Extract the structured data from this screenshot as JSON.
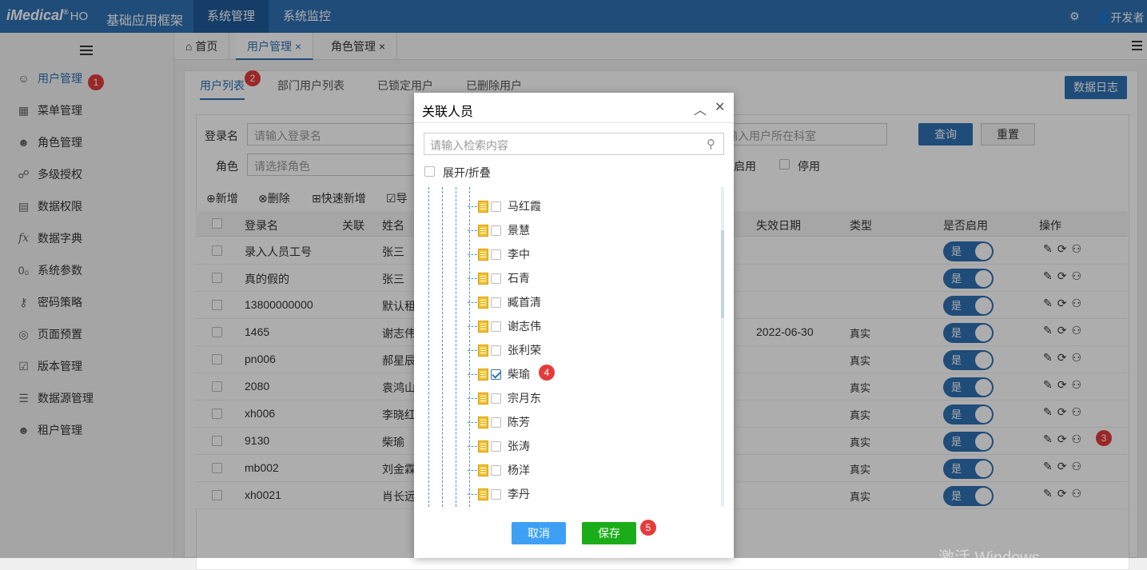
{
  "app": {
    "logo": "iMedical",
    "logo_suffix": "HO",
    "title": "基础应用框架",
    "nav": [
      "系统管理",
      "系统监控"
    ],
    "user": "开发者"
  },
  "sidebar": {
    "items": [
      {
        "label": "用户管理",
        "icon": "user-icon"
      },
      {
        "label": "菜单管理",
        "icon": "grid-icon"
      },
      {
        "label": "角色管理",
        "icon": "role-icon"
      },
      {
        "label": "多级授权",
        "icon": "multi-auth-icon"
      },
      {
        "label": "数据权限",
        "icon": "data-permission-icon"
      },
      {
        "label": "数据字典",
        "icon": "function-icon"
      },
      {
        "label": "系统参数",
        "icon": "param-icon"
      },
      {
        "label": "密码策略",
        "icon": "key-icon"
      },
      {
        "label": "页面预置",
        "icon": "layers-icon"
      },
      {
        "label": "版本管理",
        "icon": "version-icon"
      },
      {
        "label": "数据源管理",
        "icon": "datasource-icon"
      },
      {
        "label": "租户管理",
        "icon": "tenant-icon"
      }
    ]
  },
  "tabs": [
    {
      "label": "首页"
    },
    {
      "label": "用户管理",
      "close": "×"
    },
    {
      "label": "角色管理",
      "close": "×"
    }
  ],
  "subtabs": [
    "用户列表",
    "部门用户列表",
    "已锁定用户",
    "已删除用户"
  ],
  "data_log_button": "数据日志",
  "filters": {
    "login_label": "登录名",
    "login_placeholder": "请输入登录名",
    "role_label": "角色",
    "role_placeholder": "请选择角色",
    "dept_placeholder": "输入用户所在科室",
    "query": "查询",
    "reset": "重置",
    "enabled": "启用",
    "disabled": "停用"
  },
  "toolbar": [
    "新增",
    "删除",
    "快速新增",
    "导"
  ],
  "table": {
    "headers": [
      "登录名",
      "关联",
      "姓名",
      "失效日期",
      "类型",
      "是否启用",
      "操作"
    ],
    "rows": [
      {
        "login": "录入人员工号",
        "name": "张三",
        "expire": "",
        "type": "",
        "enabled": "是"
      },
      {
        "login": "真的假的",
        "name": "张三",
        "expire": "",
        "type": "",
        "enabled": "是"
      },
      {
        "login": "13800000000",
        "name": "默认租",
        "expire": "",
        "type": "",
        "enabled": "是"
      },
      {
        "login": "1465",
        "name": "谢志伟",
        "expire": "2022-06-30",
        "type": "真实",
        "enabled": "是"
      },
      {
        "login": "pn006",
        "name": "郝星辰",
        "expire": "",
        "type": "真实",
        "enabled": "是"
      },
      {
        "login": "2080",
        "name": "袁鸿山",
        "expire": "",
        "type": "真实",
        "enabled": "是"
      },
      {
        "login": "xh006",
        "name": "李晓红",
        "expire": "",
        "type": "真实",
        "enabled": "是"
      },
      {
        "login": "9130",
        "name": "柴瑜",
        "expire": "",
        "type": "真实",
        "enabled": "是"
      },
      {
        "login": "mb002",
        "name": "刘金霖",
        "expire": "",
        "type": "真实",
        "enabled": "是"
      },
      {
        "login": "xh0021",
        "name": "肖长远",
        "expire": "",
        "type": "真实",
        "enabled": "是"
      }
    ]
  },
  "dialog": {
    "title": "关联人员",
    "search_placeholder": "请输入检索内容",
    "expand_label": "展开/折叠",
    "people": [
      {
        "name": "马红霞",
        "checked": false
      },
      {
        "name": "景慧",
        "checked": false
      },
      {
        "name": "李中",
        "checked": false
      },
      {
        "name": "石青",
        "checked": false
      },
      {
        "name": "臧首清",
        "checked": false
      },
      {
        "name": "谢志伟",
        "checked": false
      },
      {
        "name": "张利荣",
        "checked": false
      },
      {
        "name": "柴瑜",
        "checked": true
      },
      {
        "name": "宗月东",
        "checked": false
      },
      {
        "name": "陈芳",
        "checked": false
      },
      {
        "name": "张涛",
        "checked": false
      },
      {
        "name": "杨洋",
        "checked": false
      },
      {
        "name": "李丹",
        "checked": false
      }
    ],
    "cancel": "取消",
    "save": "保存"
  },
  "annotations": [
    "1",
    "2",
    "3",
    "4",
    "5"
  ],
  "watermark": "激活 Windows",
  "colors": {
    "primary": "#2f70b3",
    "save": "#1aad19",
    "cancel": "#3ea0f5",
    "badge": "#e43c3c"
  }
}
